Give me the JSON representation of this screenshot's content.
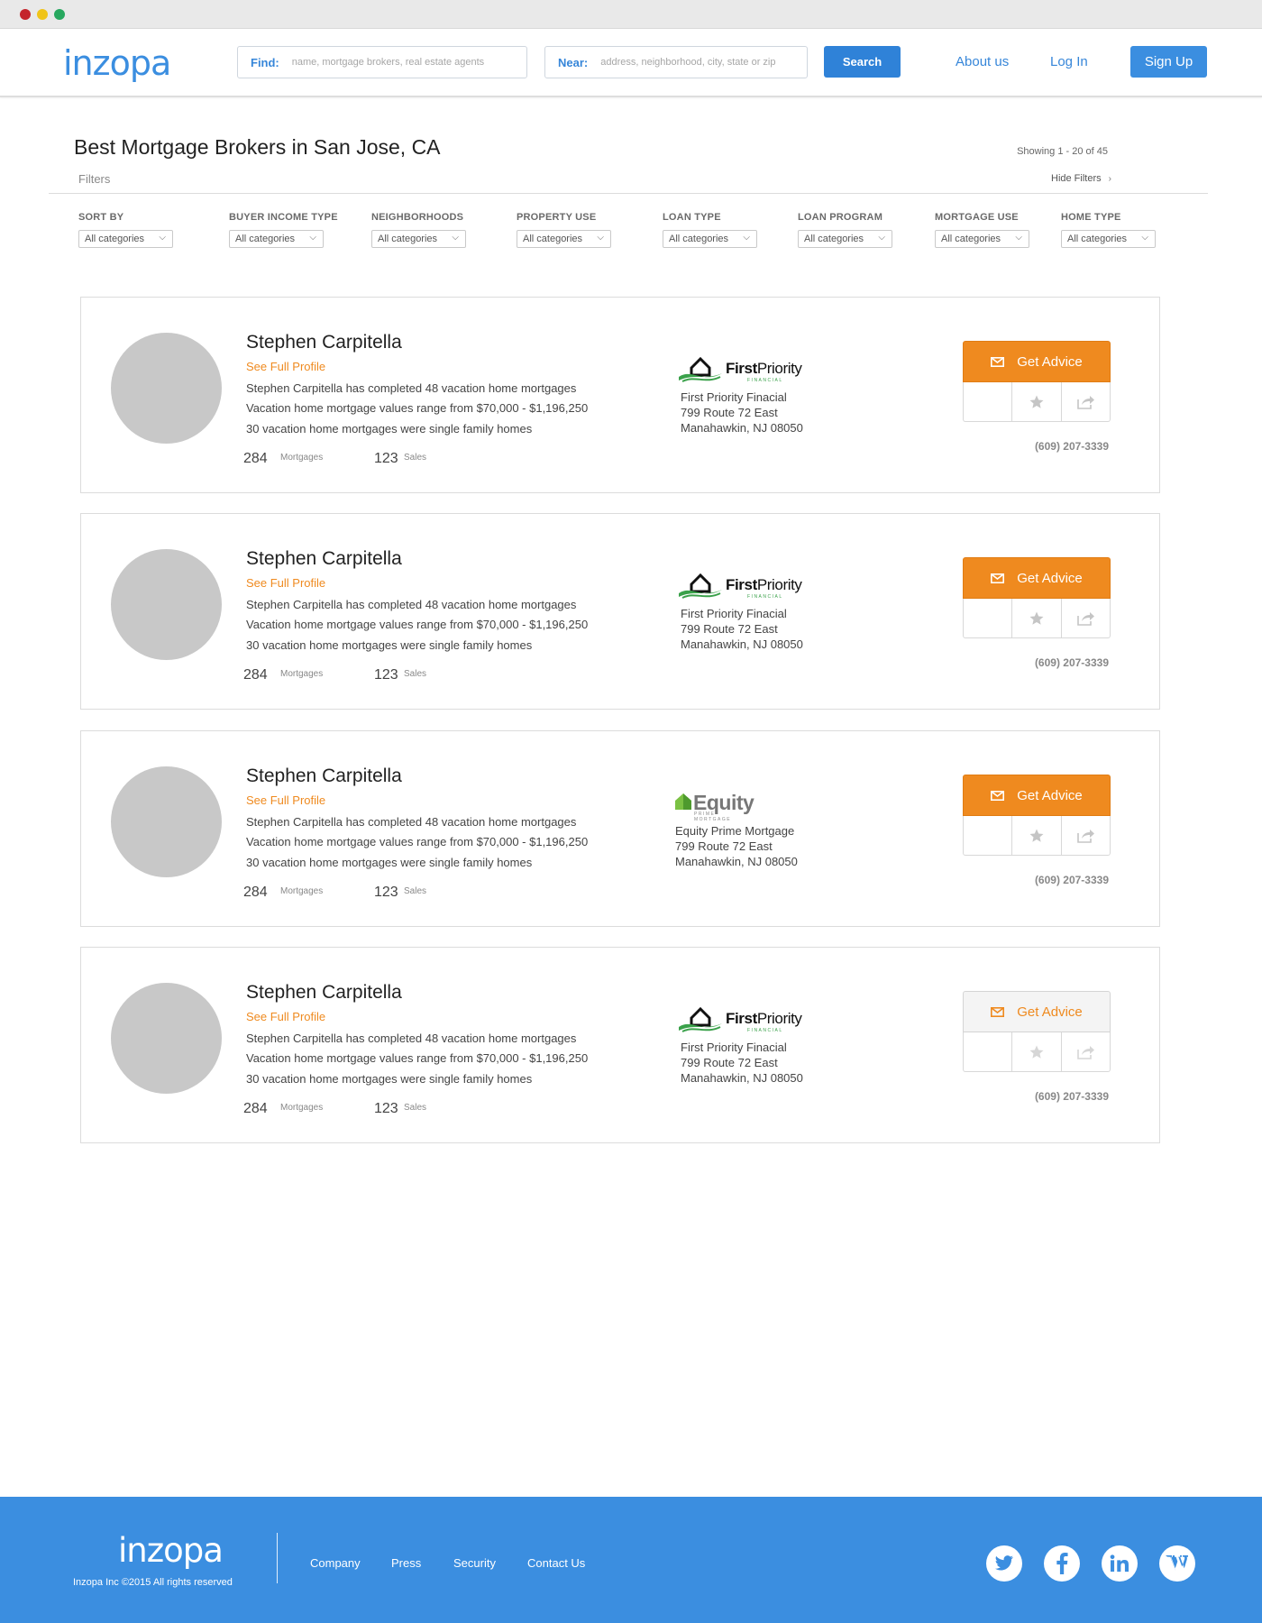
{
  "header": {
    "logo": "inzopa",
    "find_label": "Find:",
    "find_placeholder": "name, mortgage brokers, real estate agents",
    "near_label": "Near:",
    "near_placeholder": "address, neighborhood, city, state or zip",
    "search_button": "Search",
    "about": "About us",
    "login": "Log In",
    "signup": "Sign Up"
  },
  "page": {
    "title": "Best Mortgage Brokers in San Jose, CA",
    "showing": "Showing 1 - 20 of 45",
    "filters_label": "Filters",
    "hide_filters": "Hide Filters"
  },
  "filters": [
    {
      "name": "SORT BY",
      "value": "All categories"
    },
    {
      "name": "BUYER INCOME TYPE",
      "value": "All categories"
    },
    {
      "name": "NEIGHBORHOODS",
      "value": "All categories"
    },
    {
      "name": "PROPERTY USE",
      "value": "All categories"
    },
    {
      "name": "LOAN TYPE",
      "value": "All categories"
    },
    {
      "name": "LOAN PROGRAM",
      "value": "All categories"
    },
    {
      "name": "MORTGAGE USE",
      "value": "All categories"
    },
    {
      "name": "HOME TYPE",
      "value": "All categories"
    }
  ],
  "brokers": [
    {
      "name": "Stephen Carpitella",
      "profile_link": "See Full Profile",
      "line1": "Stephen Carpitella has completed 48 vacation home mortgages",
      "line2": "Vacation home mortgage values range from $70,000 - $1,196,250",
      "line3": "30 vacation home mortgages were single family homes",
      "mortgages": "284",
      "mortgages_label": "Mortgages",
      "sales": "123",
      "sales_label": "Sales",
      "logo_text_bold": "First",
      "logo_text_light": "Priority",
      "logo_sub": "FINANCIAL",
      "company": "First Priority Finacial",
      "address1": "799 Route 72 East",
      "address2": "Manahawkin, NJ 08050",
      "advice": "Get Advice",
      "phone": "(609) 207-3339"
    },
    {
      "name": "Stephen Carpitella",
      "profile_link": "See Full Profile",
      "line1": "Stephen Carpitella has completed 48 vacation home mortgages",
      "line2": "Vacation home mortgage values range from $70,000 - $1,196,250",
      "line3": "30 vacation home mortgages were single family homes",
      "mortgages": "284",
      "mortgages_label": "Mortgages",
      "sales": "123",
      "sales_label": "Sales",
      "logo_text_bold": "First",
      "logo_text_light": "Priority",
      "logo_sub": "FINANCIAL",
      "company": "First Priority Finacial",
      "address1": "799 Route 72 East",
      "address2": "Manahawkin, NJ 08050",
      "advice": "Get Advice",
      "phone": "(609) 207-3339"
    },
    {
      "name": "Stephen Carpitella",
      "profile_link": "See Full Profile",
      "line1": "Stephen Carpitella has completed 48 vacation home mortgages",
      "line2": "Vacation home mortgage values range from $70,000 - $1,196,250",
      "line3": "30 vacation home mortgages were single family homes",
      "mortgages": "284",
      "mortgages_label": "Mortgages",
      "sales": "123",
      "sales_label": "Sales",
      "logo_text": "Equity",
      "logo_sub": "PRIME MORTGAGE",
      "company": "Equity Prime Mortgage",
      "address1": "799 Route 72 East",
      "address2": "Manahawkin, NJ 08050",
      "advice": "Get Advice",
      "phone": "(609) 207-3339"
    },
    {
      "name": "Stephen Carpitella",
      "profile_link": "See Full Profile",
      "line1": "Stephen Carpitella has completed 48 vacation home mortgages",
      "line2": "Vacation home mortgage values range from $70,000 - $1,196,250",
      "line3": "30 vacation home mortgages were single family homes",
      "mortgages": "284",
      "mortgages_label": "Mortgages",
      "sales": "123",
      "sales_label": "Sales",
      "logo_text_bold": "First",
      "logo_text_light": "Priority",
      "logo_sub": "FINANCIAL",
      "company": "First Priority Finacial",
      "address1": "799 Route 72 East",
      "address2": "Manahawkin, NJ 08050",
      "advice": "Get Advice",
      "phone": "(609) 207-3339"
    }
  ],
  "footer": {
    "logo": "inzopa",
    "copyright": "Inzopa Inc ©2015 All rights reserved",
    "links": [
      "Company",
      "Press",
      "Security",
      "Contact Us"
    ],
    "social": [
      "twitter-icon",
      "facebook-icon",
      "linkedin-icon",
      "wordpress-icon"
    ]
  },
  "colors": {
    "brand_blue": "#3b8ee0",
    "accent_orange": "#ef8a1f",
    "avatar_gray": "#c8c8c8"
  }
}
